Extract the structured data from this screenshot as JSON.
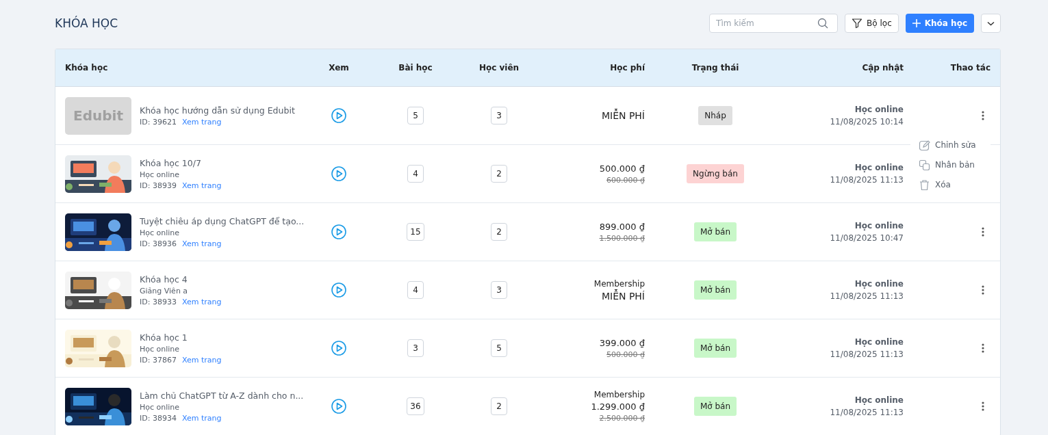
{
  "page": {
    "title": "KHÓA HỌC"
  },
  "toolbar": {
    "search": {
      "placeholder": "Tìm kiếm"
    },
    "filter_button": "Bộ lọc",
    "add_button": "Khóa học"
  },
  "table": {
    "columns": [
      "Khóa học",
      "Xem",
      "Bài học",
      "Học viên",
      "Học phí",
      "Trạng thái",
      "Cập nhật",
      "Thao tác"
    ],
    "rows": [
      {
        "thumb": {
          "kind": "text",
          "text": "Edubit"
        },
        "name": "Khóa học hướng dẫn sử dụng Edubit",
        "id": "ID: 39621",
        "link": "Xem trang",
        "lessons": "5",
        "students": "3",
        "price": "MIỄN PHÍ",
        "free": true,
        "status": {
          "label": "Nháp",
          "kind": "draft"
        },
        "type": "Học online",
        "updated": "11/08/2025 10:14",
        "menu_open": false
      },
      {
        "name": "Khóa học 10/7",
        "subtitle": "Học online",
        "id": "ID: 38939",
        "link": "Xem trang",
        "lessons": "4",
        "students": "2",
        "price": "500.000 ₫",
        "original_price": "600.000 ₫",
        "free": false,
        "status": {
          "label": "Ngừng bán",
          "kind": "stopped"
        },
        "type": "Học online",
        "updated": "11/08/2025 11:13",
        "menu_open": true
      },
      {
        "name": "Tuyệt chiêu áp dụng ChatGPT để tạo...",
        "subtitle": "Học online",
        "id": "ID: 38936",
        "link": "Xem trang",
        "lessons": "15",
        "students": "2",
        "price": "899.000 ₫",
        "original_price": "1.500.000 ₫",
        "free": false,
        "status": {
          "label": "Mở bán",
          "kind": "open"
        },
        "type": "Học online",
        "updated": "11/08/2025 10:47",
        "menu_open": false
      },
      {
        "name": "Khóa học 4",
        "subtitle": "Giảng Viên a",
        "id": "ID: 38933",
        "link": "Xem trang",
        "lessons": "4",
        "students": "3",
        "plan": "Membership",
        "price": "MIỄN PHÍ",
        "free": true,
        "status": {
          "label": "Mở bán",
          "kind": "open"
        },
        "type": "Học online",
        "updated": "11/08/2025 11:13",
        "menu_open": false
      },
      {
        "name": "Khóa học 1",
        "subtitle": "Học online",
        "id": "ID: 37867",
        "link": "Xem trang",
        "lessons": "3",
        "students": "5",
        "price": "399.000 ₫",
        "original_price": "500.000 ₫",
        "free": false,
        "status": {
          "label": "Mở bán",
          "kind": "open"
        },
        "type": "Học online",
        "updated": "11/08/2025 11:13",
        "menu_open": false
      },
      {
        "name": "Làm chủ ChatGPT từ A-Z dành cho n...",
        "subtitle": "Học online",
        "id": "ID: 38934",
        "link": "Xem trang",
        "lessons": "36",
        "students": "2",
        "plan": "Membership",
        "price": "1.299.000 ₫",
        "original_price": "2.500.000 ₫",
        "free": false,
        "status": {
          "label": "Mở bán",
          "kind": "open"
        },
        "type": "Học online",
        "updated": "11/08/2025 11:13",
        "menu_open": false
      }
    ]
  },
  "action_menu": [
    {
      "label": "Chỉnh sửa",
      "kind": "edit"
    },
    {
      "label": "Nhân bản",
      "kind": "copy"
    },
    {
      "label": "Xóa",
      "kind": "delete"
    }
  ]
}
